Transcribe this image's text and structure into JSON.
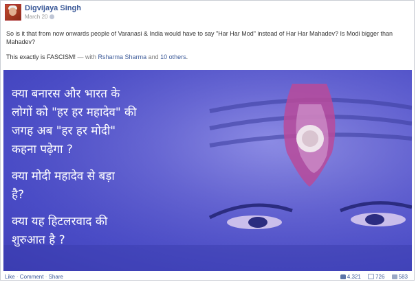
{
  "post": {
    "author": "Digvijaya Singh",
    "date": "March 20",
    "body_text": "So is it that from now onwards people of Varanasi & India would have to say \"Har Har Mod\" instead of Har Har Mahadev? Is Modi bigger than Mahadev?",
    "fascism_text": "This exactly is FASCISM!",
    "with_text": " — with ",
    "tagged_person": "Rsharma Sharma",
    "and_text": " and ",
    "others_link": "10 others",
    "period": "."
  },
  "image_text": {
    "line1": "क्या बनारस और भारत के",
    "line2": "लोगों को \"हर हर महादेव\" की",
    "line3": "जगह अब \"हर हर मोदी\"",
    "line4": "कहना पढ़ेगा ?",
    "line5": "क्या मोदी महादेव से बड़ा",
    "line6": "है?",
    "line7": "क्या यह  हिटलरवाद की",
    "line8": "शुरुआत है ?"
  },
  "footer": {
    "like": "Like",
    "dot1": " · ",
    "comment": "Comment",
    "dot2": " · ",
    "share": "Share",
    "like_count": "4,321",
    "comment_count": "726",
    "share_count": "583"
  },
  "icons": [
    "globe-icon",
    "like-count-icon",
    "comment-count-icon",
    "share-count-icon"
  ]
}
